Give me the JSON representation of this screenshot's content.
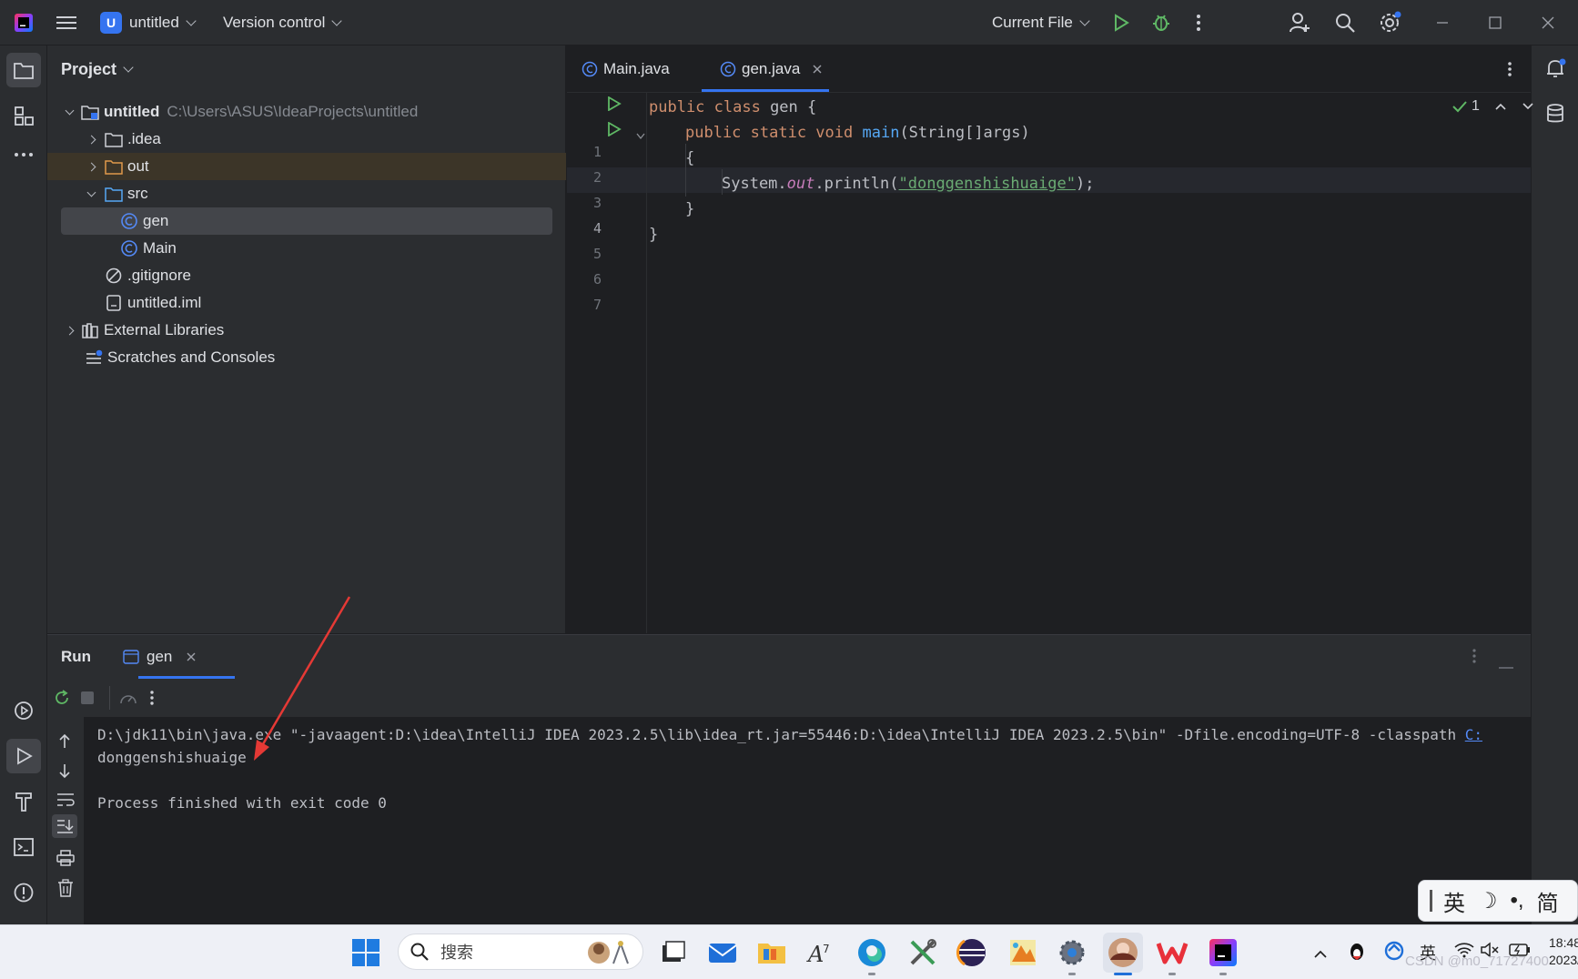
{
  "titlebar": {
    "project_badge": "U",
    "project_name": "untitled",
    "vcs_label": "Version control",
    "run_config": "Current File"
  },
  "project_panel": {
    "title": "Project",
    "root_name": "untitled",
    "root_path": "C:\\Users\\ASUS\\IdeaProjects\\untitled",
    "items": [
      {
        "label": ".idea"
      },
      {
        "label": "out"
      },
      {
        "label": "src"
      },
      {
        "label": "gen"
      },
      {
        "label": "Main"
      },
      {
        "label": ".gitignore"
      },
      {
        "label": "untitled.iml"
      },
      {
        "label": "External Libraries"
      },
      {
        "label": "Scratches and Consoles"
      }
    ]
  },
  "editor": {
    "tabs": [
      {
        "label": "Main.java"
      },
      {
        "label": "gen.java"
      }
    ],
    "inspection_count": "1",
    "line_numbers": [
      "1",
      "2",
      "3",
      "4",
      "5",
      "6",
      "7"
    ],
    "code": {
      "l1_kw": "public class",
      "l1_rest": " gen {",
      "l2_kw": "public static void",
      "l2_fn": "main",
      "l2_rest": "(String[]args)",
      "l3": "{",
      "l4_a": "System.",
      "l4_out": "out",
      "l4_b": ".println(",
      "l4_str": "\"donggenshishuaige\"",
      "l4_c": ");",
      "l5": "}",
      "l6": "}"
    }
  },
  "run_panel": {
    "title": "Run",
    "tab_label": "gen",
    "output": [
      "D:\\jdk11\\bin\\java.exe \"-javaagent:D:\\idea\\IntelliJ IDEA 2023.2.5\\lib\\idea_rt.jar=55446:D:\\idea\\IntelliJ IDEA 2023.2.5\\bin\" -Dfile.encoding=UTF-8 -classpath",
      "donggenshishuaige",
      "Process finished with exit code 0"
    ],
    "classpath_link": "C:"
  },
  "taskbar": {
    "search_placeholder": "搜索",
    "lang_indicator": "英",
    "clock": "18:48",
    "date_partial": "2023/"
  },
  "ime": {
    "mode": "英",
    "moon": "☽",
    "punct": "•,",
    "simplified": "简"
  },
  "watermark": "CSDN @m0_71727400",
  "colors": {
    "accent": "#3574f0",
    "run_green": "#5fb865",
    "string_green": "#6aab73",
    "keyword": "#cf8e6d",
    "function": "#56a8f5",
    "annotation_arrow": "#e53935"
  }
}
